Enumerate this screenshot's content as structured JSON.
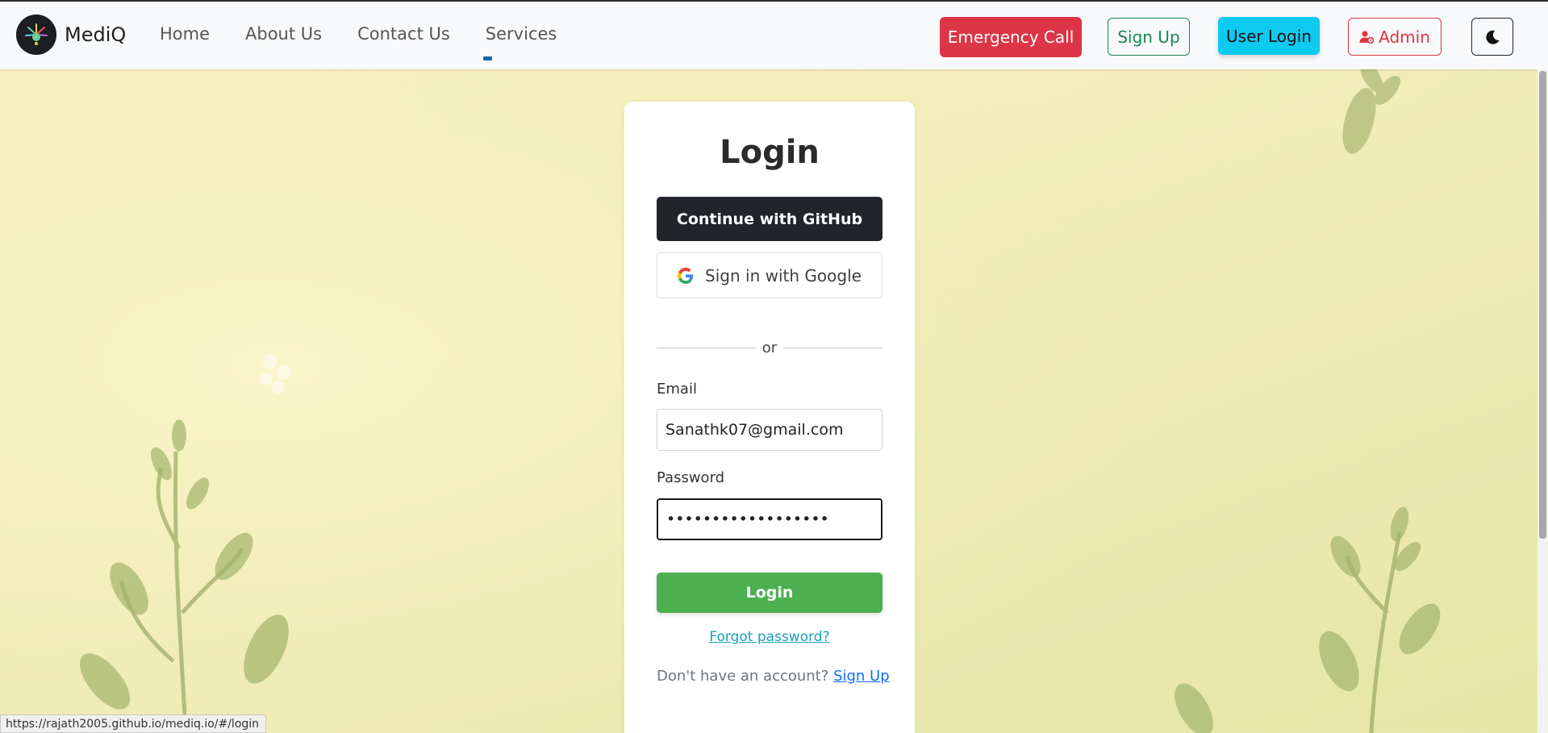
{
  "navbar": {
    "brand": "MediQ",
    "links": [
      "Home",
      "About Us",
      "Contact Us",
      "Services"
    ],
    "emergency_label": "Emergency Call",
    "signup_label": "Sign Up",
    "user_login_label": "User Login",
    "admin_label": "Admin"
  },
  "login": {
    "title": "Login",
    "github_label": "Continue with GitHub",
    "google_label": "Sign in with Google",
    "divider": "or",
    "email_label": "Email",
    "email_value": "Sanathk07@gmail.com",
    "password_label": "Password",
    "password_value": "••••••••••••••••••",
    "submit_label": "Login",
    "forgot_label": "Forgot password?",
    "no_account_text": "Don't have an account?",
    "signup_link": "Sign Up"
  },
  "status_url": "https://rajath2005.github.io/mediq.io/#/login",
  "colors": {
    "emergency": "#dc3545",
    "signup": "#198754",
    "user_login": "#0dcaf0",
    "admin": "#dc3545",
    "github": "#212529",
    "login_button": "#4caf50",
    "forgot_link": "#17a2b8",
    "signup_link": "#0d6efd"
  }
}
